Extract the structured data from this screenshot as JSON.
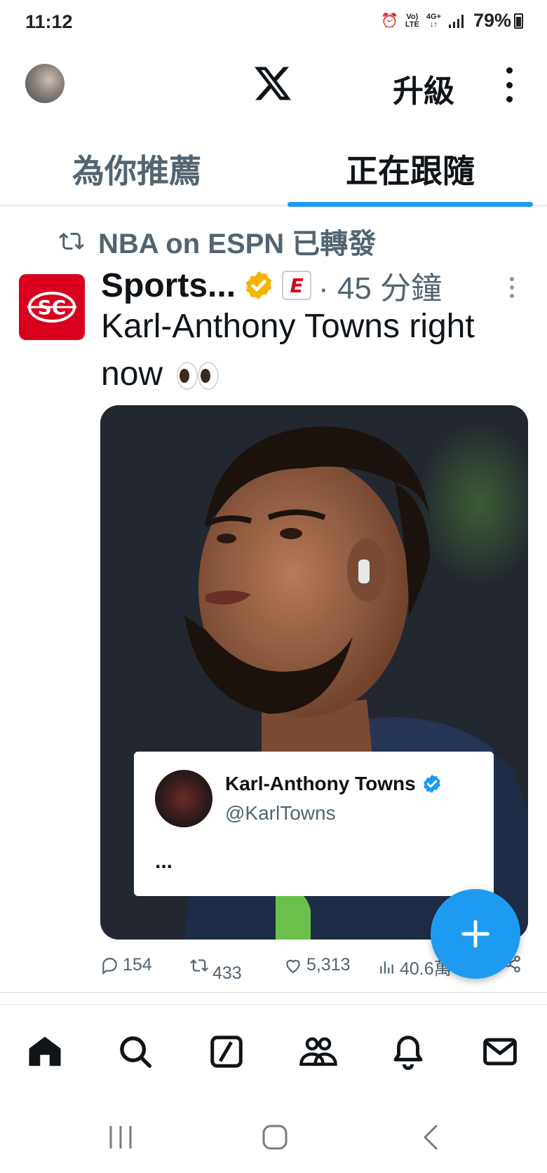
{
  "status_bar": {
    "time": "11:12",
    "network_top": "Vo)",
    "network_bottom": "LTE",
    "data_type": "4G+",
    "battery": "79%"
  },
  "header": {
    "logo": "x-logo",
    "upgrade_label": "升級"
  },
  "tabs": [
    {
      "label": "為你推薦",
      "active": false
    },
    {
      "label": "正在跟隨",
      "active": true
    }
  ],
  "tweet": {
    "retweeted_by": "NBA on ESPN 已轉發",
    "author_name": "Sports...",
    "time": "· 45 分鐘",
    "avatar_text": "SC",
    "badge_text": "E",
    "text": "Karl-Anthony Towns right now",
    "quote_card": {
      "name": "Karl-Anthony Towns",
      "handle": "@KarlTowns",
      "body": "..."
    },
    "stats": {
      "replies": "154",
      "retweets": "433",
      "likes": "5,313",
      "views": "40.6萬"
    }
  },
  "colors": {
    "accent": "#1d9bf0",
    "verified_gold": "#f4b400",
    "espn_red": "#d8001c",
    "secondary_text": "#536471"
  },
  "bottom_nav": [
    "home-icon",
    "search-icon",
    "grok-icon",
    "communities-icon",
    "notifications-icon",
    "messages-icon"
  ]
}
